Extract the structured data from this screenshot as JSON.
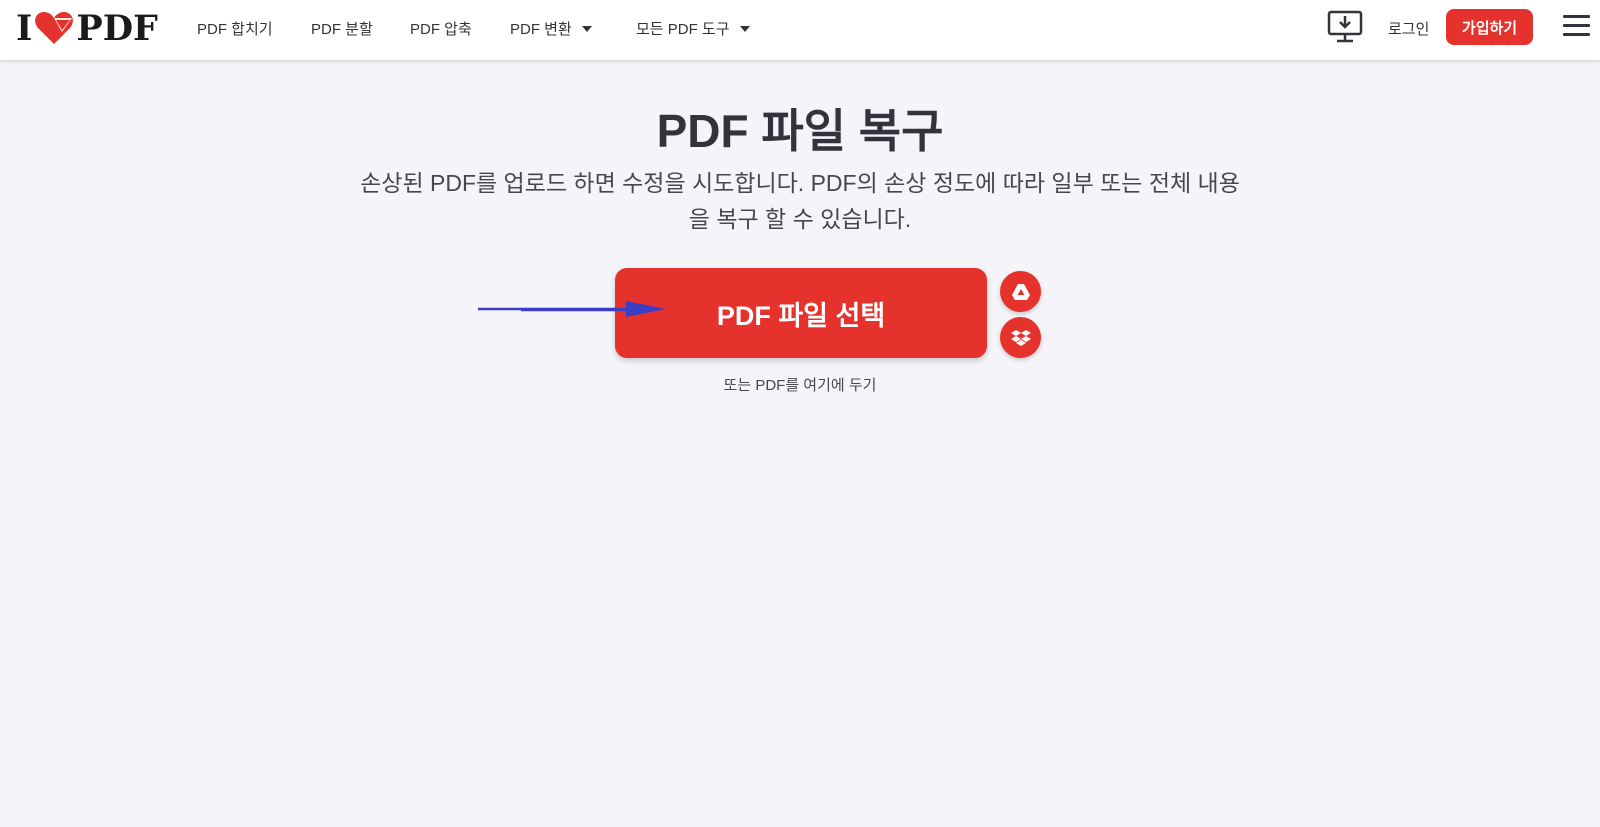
{
  "header": {
    "logo": {
      "left": "I",
      "right": "PDF"
    },
    "nav": [
      {
        "label": "PDF 합치기"
      },
      {
        "label": "PDF 분할"
      },
      {
        "label": "PDF 압축"
      },
      {
        "label": "PDF 변환"
      },
      {
        "label": "모든 PDF 도구"
      }
    ],
    "login": "로그인",
    "signup": "가입하기"
  },
  "main": {
    "title": "PDF 파일 복구",
    "subtitle": "손상된 PDF를 업로드 하면 수정을 시도합니다. PDF의 손상 정도에 따라 일부 또는 전체 내용을 복구 할 수 있습니다.",
    "select_button": "PDF 파일 선택",
    "drop_hint": "또는 PDF를 여기에 두기"
  },
  "icons": {
    "desktop": "desktop-download-icon",
    "menu": "hamburger-menu-icon",
    "google_drive": "google-drive-icon",
    "dropbox": "dropbox-icon",
    "annotation": "blue-arrow-icon"
  },
  "colors": {
    "brand_red": "#e5322d",
    "background": "#f5f4f9",
    "text": "#33333b",
    "annotation_arrow": "#3b3fc4"
  }
}
